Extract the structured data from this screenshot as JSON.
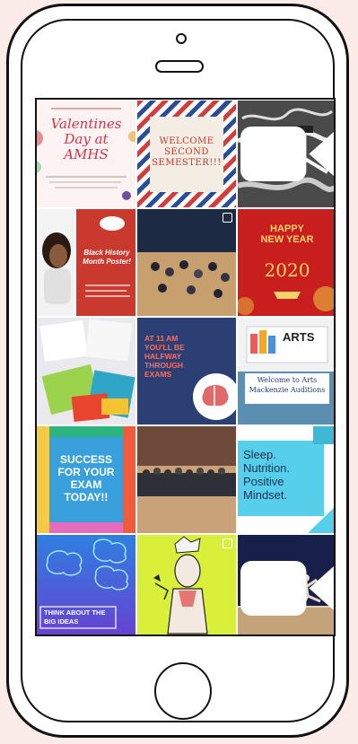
{
  "posts": [
    {
      "caption": "Valentines Day at AMHS"
    },
    {
      "caption": "WELCOME SECOND SEMESTER!!!"
    },
    {
      "caption": ""
    },
    {
      "caption": "Black History Month Poster!"
    },
    {
      "caption": ""
    },
    {
      "caption_line1": "HAPPY",
      "caption_line2": "NEW YEAR",
      "year": "2020"
    },
    {
      "caption": ""
    },
    {
      "caption": "AT 11 AM YOU'LL BE HALFWAY THROUGH EXAMS"
    },
    {
      "caption_line1": "ARTS",
      "caption_line2": "Welcome to Arts Mackenzie Auditions"
    },
    {
      "caption": "SUCCESS FOR YOUR EXAM TODAY!!"
    },
    {
      "caption": ""
    },
    {
      "caption": "Sleep. Nutrition. Positive Mindset."
    },
    {
      "caption": "THINK ABOUT THE BIG IDEAS"
    },
    {
      "caption": ""
    },
    {
      "caption": ""
    }
  ],
  "colors": {
    "accent_red": "#d8322a",
    "teal": "#1fb6d4",
    "navy": "#223a70"
  }
}
